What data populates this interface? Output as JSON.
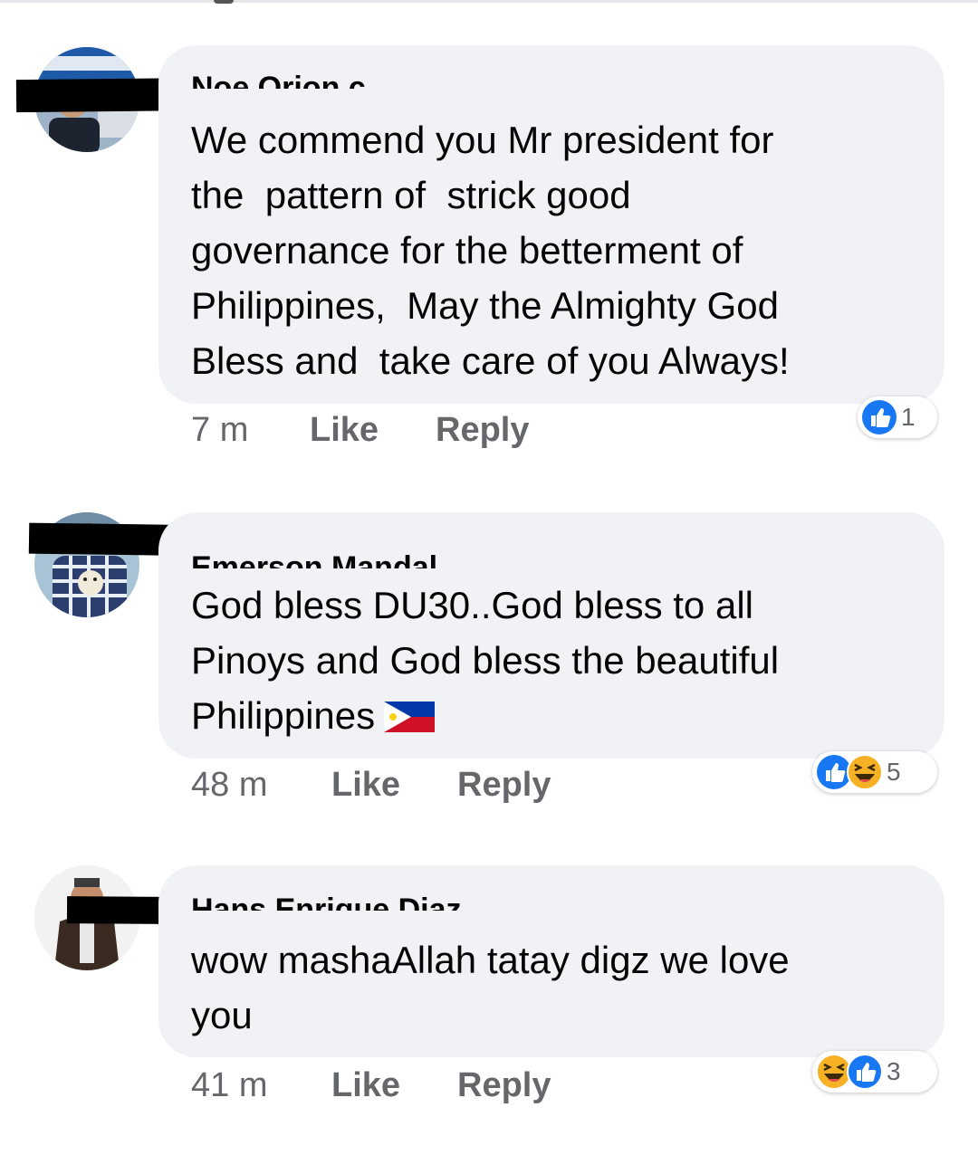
{
  "comments": [
    {
      "author": "Noe Orion c",
      "text": "We commend you Mr president for\nthe  pattern of  strick good\ngovernance for the betterment of\nPhilippines,  May the Almighty God\nBless and  take care of you Always!",
      "time": "7 m",
      "like_label": "Like",
      "reply_label": "Reply",
      "reactions": [
        "like-icon"
      ],
      "reaction_count": "1"
    },
    {
      "author": "Emerson Mandal",
      "text": "God bless DU30..God bless to all\nPinoys and God bless the beautiful\nPhilippines",
      "emoji": "philippine-flag-icon",
      "time": "48 m",
      "like_label": "Like",
      "reply_label": "Reply",
      "reactions": [
        "like-icon",
        "haha-icon"
      ],
      "reaction_count": "5"
    },
    {
      "author": "Hans Enrique Diaz",
      "text": "wow mashaAllah tatay digz we love\nyou",
      "time": "41 m",
      "like_label": "Like",
      "reply_label": "Reply",
      "reactions": [
        "haha-icon",
        "like-icon"
      ],
      "reaction_count": "3"
    }
  ],
  "colors": {
    "bubble": "#f0f2f5",
    "meta_text": "#65676b",
    "like_blue": "#1877f2",
    "haha_yellow": "#f7b125"
  }
}
